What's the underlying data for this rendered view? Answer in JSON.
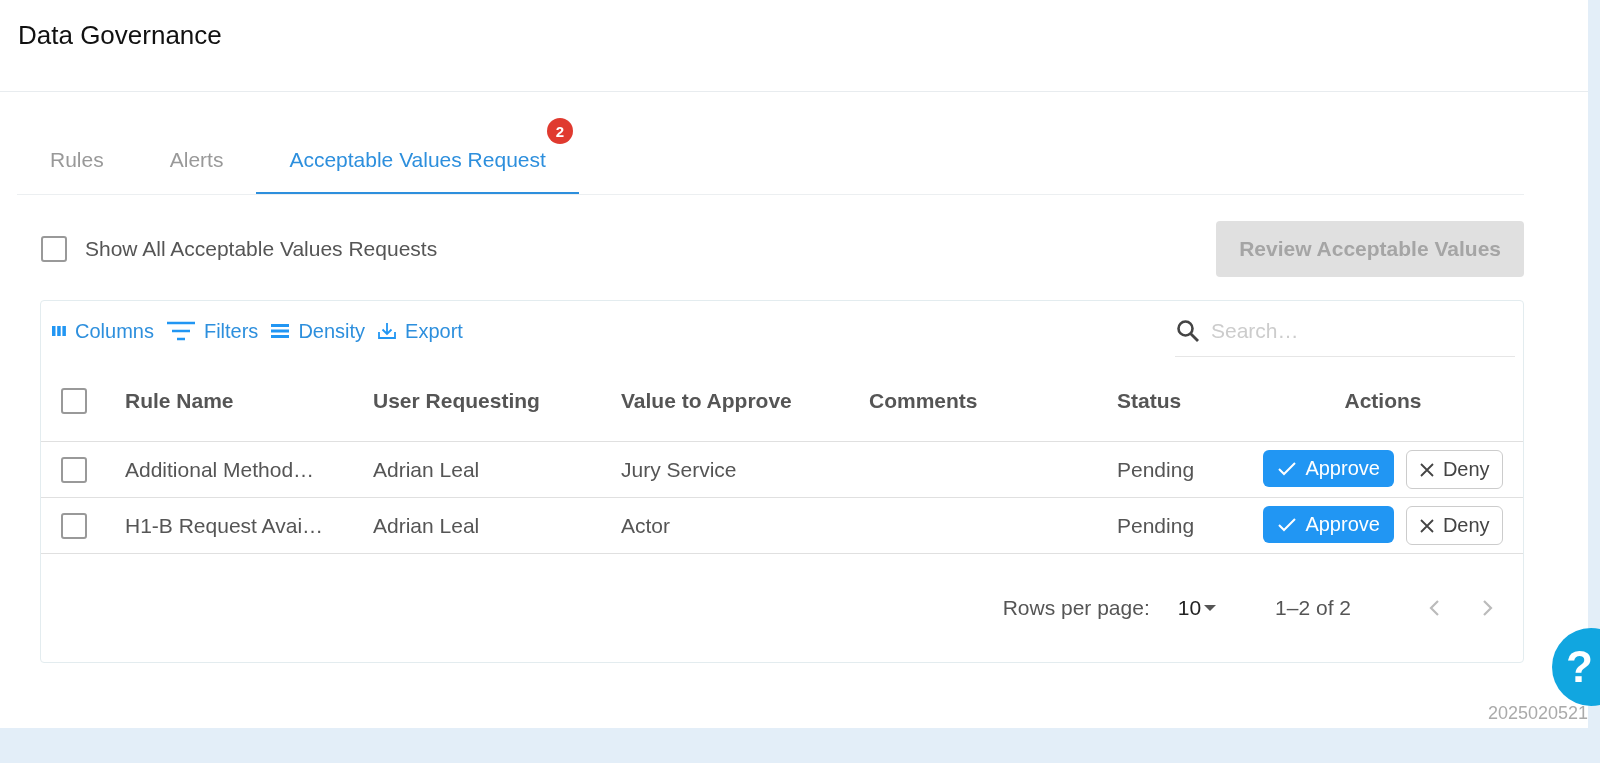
{
  "header": {
    "title": "Data Governance"
  },
  "tabs": [
    {
      "label": "Rules",
      "selected": false
    },
    {
      "label": "Alerts",
      "selected": false
    },
    {
      "label": "Acceptable Values Request",
      "selected": true,
      "badge": "2"
    }
  ],
  "show_all": {
    "label": "Show All Acceptable Values Requests",
    "checked": false
  },
  "review_button": {
    "label": "Review Acceptable Values",
    "disabled": true
  },
  "toolbar": [
    {
      "kind": "columns",
      "label": "Columns"
    },
    {
      "kind": "filters",
      "label": "Filters"
    },
    {
      "kind": "density",
      "label": "Density"
    },
    {
      "kind": "export",
      "label": "Export"
    }
  ],
  "search": {
    "placeholder": "Search…"
  },
  "table": {
    "select_all_checked": false,
    "columns": [
      "Rule Name",
      "User Requesting",
      "Value to Approve",
      "Comments",
      "Status",
      "Actions"
    ],
    "rows": [
      {
        "checked": false,
        "rule_name": "Additional Method…",
        "user": "Adrian Leal",
        "value": "Jury Service",
        "comments": "",
        "status": "Pending",
        "approve": "Approve",
        "deny": "Deny"
      },
      {
        "checked": false,
        "rule_name": "H1-B Request Avai…",
        "user": "Adrian Leal",
        "value": "Actor",
        "comments": "",
        "status": "Pending",
        "approve": "Approve",
        "deny": "Deny"
      }
    ]
  },
  "pagination": {
    "rows_per_page_label": "Rows per page:",
    "rows_per_page": "10",
    "range": "1–2 of 2"
  },
  "help_button": {
    "label": "?"
  },
  "version": "2025020521"
}
